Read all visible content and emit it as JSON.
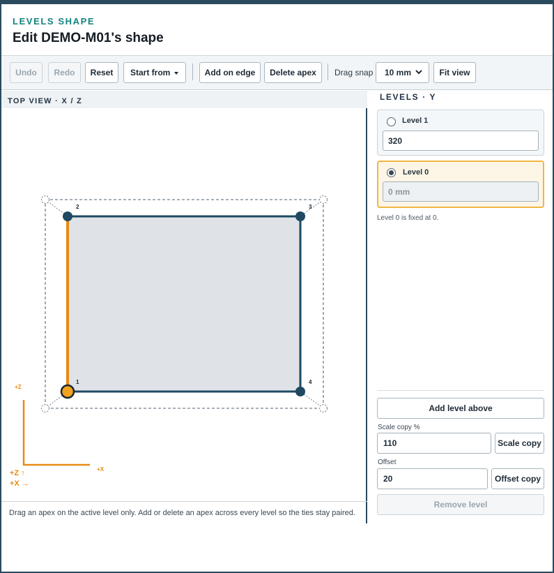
{
  "header": {
    "eyebrow": "LEVELS SHAPE",
    "title": "Edit DEMO-M01's shape"
  },
  "toolbar": {
    "undo": "Undo",
    "redo": "Redo",
    "reset": "Reset",
    "start_from": "Start from",
    "add_on_edge": "Add on edge",
    "delete_apex": "Delete apex",
    "drag_snap_label": "Drag snap",
    "drag_snap_value": "10 mm",
    "fit_view": "Fit view",
    "undo_enabled": false,
    "redo_enabled": false
  },
  "canvas": {
    "heading": "TOP VIEW · X / Z",
    "apex_labels": [
      "1",
      "2",
      "3",
      "4"
    ],
    "active_edge": "1-2",
    "axis_z_small": "+Z",
    "axis_x_small": "+X",
    "legend_z": "+Z ↑",
    "legend_x": "+X →",
    "hint": "Drag an apex on the active level only. Add or delete an apex across every level so the ties stay paired.",
    "colors": {
      "active": "#e88a14",
      "outline": "#1f4863",
      "fill": "#dfe3e7",
      "ghost": "#8a96a0"
    }
  },
  "levels_panel": {
    "heading": "LEVELS · Y",
    "levels": [
      {
        "name": "Level 1",
        "value": "320",
        "selected": false
      },
      {
        "name": "Level 0",
        "value": "0 mm",
        "selected": true
      }
    ],
    "note": "Level 0 is fixed at 0.",
    "add_level_above": "Add level above",
    "scale_copy_label": "Scale copy %",
    "scale_copy_value": "110",
    "scale_copy_button": "Scale copy",
    "offset_label": "Offset",
    "offset_value": "20",
    "offset_copy_button": "Offset copy",
    "remove_level": "Remove level"
  }
}
